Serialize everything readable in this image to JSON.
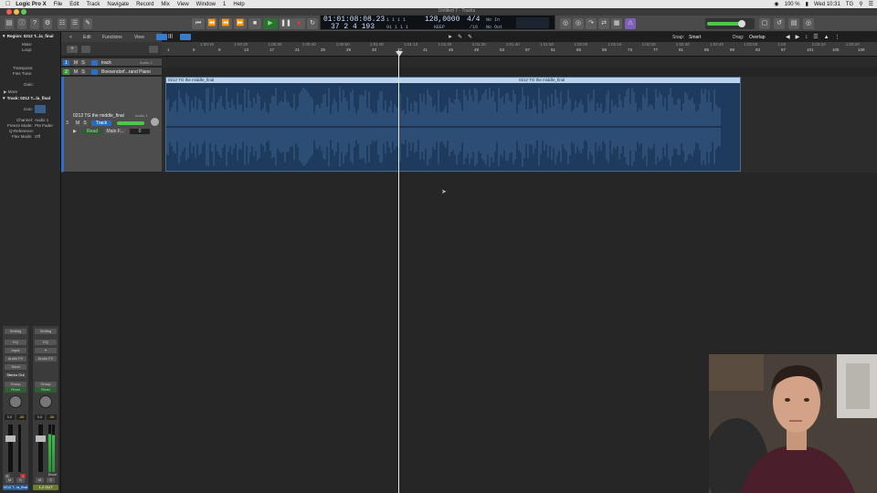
{
  "menubar": {
    "apple_icon": "apple-icon",
    "items": [
      "Logic Pro X",
      "File",
      "Edit",
      "Track",
      "Navigate",
      "Record",
      "Mix",
      "View",
      "Window",
      "1",
      "Help"
    ],
    "right": {
      "battery": "100 %",
      "time": "Wed 10:31",
      "user": "TG"
    }
  },
  "window": {
    "title": "Untitled 7 - Tracks"
  },
  "lcd": {
    "time_position": "01:01:08:08.23",
    "time_sub": "1   1   1     1",
    "bar_position": "37  2  4  193",
    "bar_sub": "91   1   1     1",
    "tempo": "128,0000",
    "key": "KEEP",
    "sig_top": "4/4",
    "sig_bottom": "/16",
    "in_label": "No In",
    "out_label": "No Out"
  },
  "edit_bar": {
    "back": "<",
    "edit": "Edit",
    "functions": "Functions",
    "view": "View",
    "snap_label": "Snap:",
    "snap_value": "Smart",
    "drag_label": "Drag:",
    "drag_value": "Overlap"
  },
  "inspector": {
    "region_label": "Region:",
    "region_name": "0212 T...la_final",
    "rows": [
      "Mute:",
      "Loop:",
      "",
      "Transpose:",
      "Fine Tune:",
      "",
      "Gain:"
    ],
    "more": "More",
    "track_label": "Track:",
    "track_name": "0212 T...la_final",
    "icon_label": "Icon:",
    "channel_label": "Channel:",
    "channel_value": "Audio 1",
    "freeze_label": "Freeze Mode:",
    "freeze_value": "Pre Fader",
    "qref_label": "Q-Reference:",
    "flex_label": "Flex Mode:",
    "flex_value": "Off"
  },
  "strip1": {
    "setting": "Setting",
    "eq": "EQ",
    "input": "Input",
    "audiofx": "Audio FX",
    "send": "Send",
    "output": "Stereo Out",
    "group": "Group",
    "read": "Read",
    "vol": "0,0",
    "peak": "-58",
    "bottom": "0212 T...la_final",
    "m": "M",
    "s": "S",
    "r": "R",
    "i": "I"
  },
  "strip2": {
    "setting": "Setting",
    "eq": "EQ",
    "audiofx": "Audio FX",
    "group": "Group",
    "read": "Read",
    "vol": "0,0",
    "peak": "-58",
    "bounce": "Bnce",
    "bottom": "1-2 OUT",
    "m": "M",
    "s": "S"
  },
  "tracks": [
    {
      "num": "1",
      "m": "M",
      "s": "S",
      "name": "track",
      "right": "Audio 2"
    },
    {
      "num": "2",
      "m": "M",
      "s": "S",
      "name": "Boesendorf...rand Piano",
      "right": ""
    },
    {
      "num": "3",
      "m": "M",
      "s": "S",
      "name": "0212 TG the middle_final",
      "right": "Audio 1",
      "read": "Read",
      "main": "Main F...",
      "track_btn": "Track",
      "zero": "0"
    }
  ],
  "ruler": {
    "bars": [
      "1",
      "5",
      "9",
      "13",
      "17",
      "21",
      "25",
      "29",
      "33",
      "37",
      "41",
      "45",
      "49",
      "53",
      "57",
      "61",
      "65",
      "69",
      "73",
      "77",
      "81",
      "85",
      "89",
      "93",
      "97",
      "101",
      "105",
      "109"
    ],
    "times": [
      "1:00:10",
      "1:00:20",
      "1:00:30",
      "1:00:40",
      "1:00:50",
      "1:01:00",
      "1:01:10",
      "1:01:20",
      "1:01:30",
      "1:01:40",
      "1:01:50",
      "1:02:00",
      "1:02:10",
      "1:02:20",
      "1:02:30",
      "1:02:40",
      "1:02:50",
      "1:03",
      "1:03:10",
      "1:03:20"
    ]
  },
  "region": {
    "name": "0212 TG the middle_final",
    "name2": "0212 TG the middle_final"
  },
  "colors": {
    "accent": "#2a7bd6",
    "region": "#1e3a5c",
    "play": "#3fb84a",
    "record": "#d33"
  }
}
